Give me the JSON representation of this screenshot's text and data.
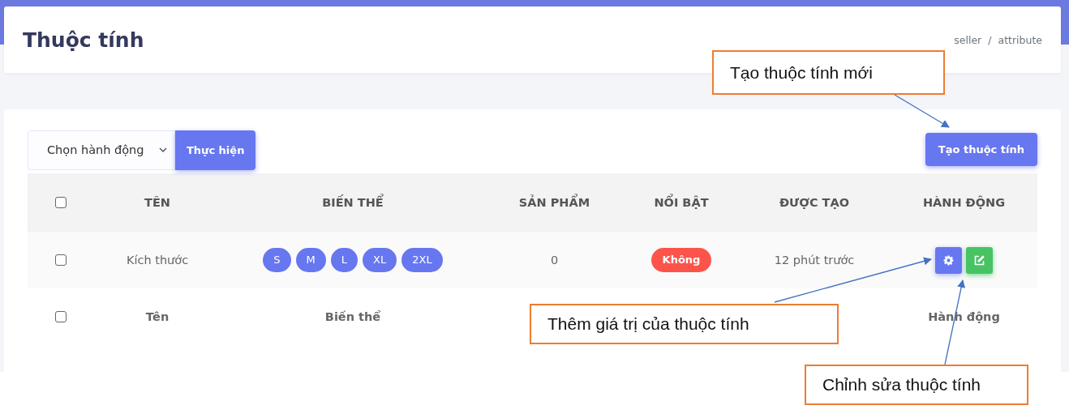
{
  "header": {
    "title": "Thuộc tính",
    "breadcrumb": [
      "seller",
      "attribute"
    ],
    "breadcrumb_separator": "/"
  },
  "toolbar": {
    "action_select": {
      "value": "Chọn hành động"
    },
    "apply_button": "Thực hiện",
    "create_button": "Tạo thuộc tính"
  },
  "table": {
    "select_all": {
      "checked": false
    },
    "columns": [
      "TÊN",
      "BIẾN THỂ",
      "SẢN PHẨM",
      "NỔI BẬT",
      "ĐƯỢC TẠO",
      "HÀNH ĐỘNG"
    ],
    "rows": [
      {
        "checked": false,
        "name": "Kích thước",
        "variants": [
          "S",
          "M",
          "L",
          "XL",
          "2XL"
        ],
        "products": "0",
        "featured": {
          "label": "Không",
          "kind": "no"
        },
        "created": "12 phút trước"
      }
    ],
    "footer": {
      "checked": false,
      "name": "Tên",
      "variants": "Biến thể",
      "actions": "Hành động"
    }
  },
  "callouts": [
    {
      "text": "Tạo thuộc tính mới"
    },
    {
      "text": "Thêm giá trị của thuộc tính"
    },
    {
      "text": "Chỉnh sửa thuộc tính"
    }
  ]
}
